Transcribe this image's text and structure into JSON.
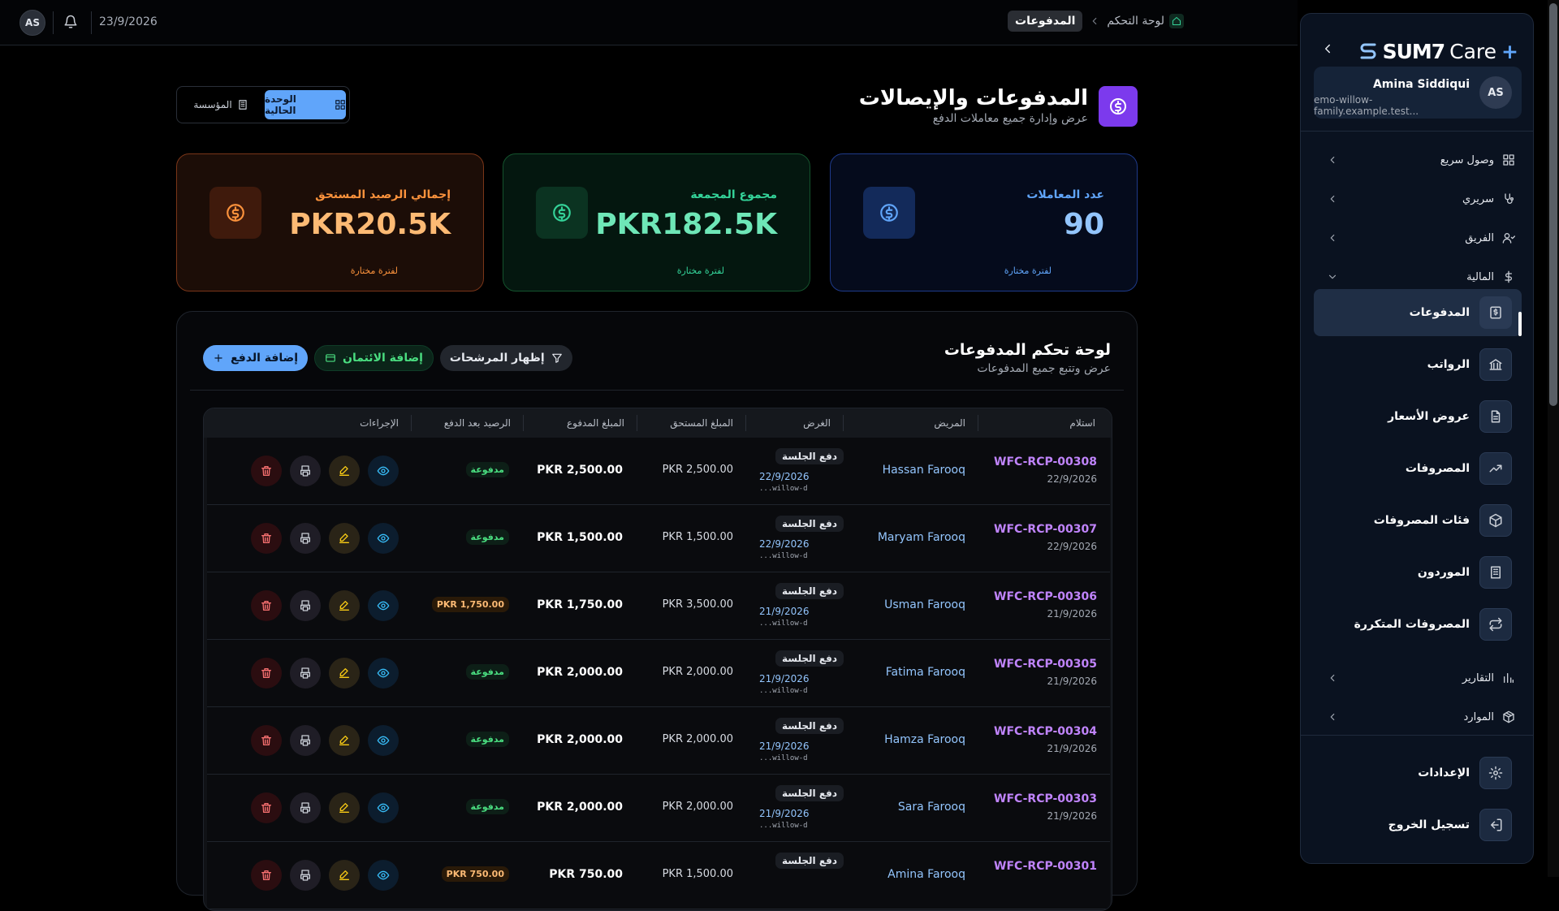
{
  "topbar": {
    "avatar_initials": "AS",
    "date": "23/9/2026",
    "breadcrumb_home": "لوحة التحكم",
    "breadcrumb_current": "المدفوعات"
  },
  "header": {
    "title": "المدفوعات والإيصالات",
    "subtitle": "عرض وإدارة جميع معاملات الدفع",
    "scope_current": "الوحدة الحالية",
    "scope_org": "المؤسسة"
  },
  "cards": {
    "transactions": {
      "title": "عدد المعاملات",
      "value": "90",
      "sub": "لفترة مختارة"
    },
    "collected": {
      "title": "مجموع المجمعة",
      "value": "PKR182.5K",
      "sub": "لفترة مختارة"
    },
    "balance": {
      "title": "إجمالي الرصيد المستحق",
      "value": "PKR20.5K",
      "sub": "لفترة مختارة"
    }
  },
  "panel": {
    "title": "لوحة تحكم المدفوعات",
    "subtitle": "عرض وتتبع جميع المدفوعات",
    "btn_filters": "إظهار المرشحات",
    "btn_credit": "إضافة الائتمان",
    "btn_add_payment": "إضافة الدفع"
  },
  "table": {
    "columns": [
      "استلام",
      "المريض",
      "الغرض",
      "المبلغ المستحق",
      "المبلغ المدفوع",
      "الرصيد بعد الدفع",
      "الإجراءات"
    ],
    "rows": [
      {
        "receipt": "WFC-RCP-00308",
        "date": "22/9/2026",
        "patient": "Hassan Farooq",
        "purpose": "دفع الجلسة",
        "purpose_date": "22/9/2026",
        "ref": "...willow-d",
        "due": "PKR 2,500.00",
        "paid": "PKR 2,500.00",
        "balance": "مدفوعة",
        "settled": true
      },
      {
        "receipt": "WFC-RCP-00307",
        "date": "22/9/2026",
        "patient": "Maryam Farooq",
        "purpose": "دفع الجلسة",
        "purpose_date": "22/9/2026",
        "ref": "...willow-d",
        "due": "PKR 1,500.00",
        "paid": "PKR 1,500.00",
        "balance": "مدفوعة",
        "settled": true
      },
      {
        "receipt": "WFC-RCP-00306",
        "date": "21/9/2026",
        "patient": "Usman Farooq",
        "purpose": "دفع الجلسة",
        "purpose_date": "21/9/2026",
        "ref": "...willow-d",
        "due": "PKR 3,500.00",
        "paid": "PKR 1,750.00",
        "balance": "PKR 1,750.00",
        "settled": false
      },
      {
        "receipt": "WFC-RCP-00305",
        "date": "21/9/2026",
        "patient": "Fatima Farooq",
        "purpose": "دفع الجلسة",
        "purpose_date": "21/9/2026",
        "ref": "...willow-d",
        "due": "PKR 2,000.00",
        "paid": "PKR 2,000.00",
        "balance": "مدفوعة",
        "settled": true
      },
      {
        "receipt": "WFC-RCP-00304",
        "date": "21/9/2026",
        "patient": "Hamza Farooq",
        "purpose": "دفع الجلسة",
        "purpose_date": "21/9/2026",
        "ref": "...willow-d",
        "due": "PKR 2,000.00",
        "paid": "PKR 2,000.00",
        "balance": "مدفوعة",
        "settled": true
      },
      {
        "receipt": "WFC-RCP-00303",
        "date": "21/9/2026",
        "patient": "Sara Farooq",
        "purpose": "دفع الجلسة",
        "purpose_date": "21/9/2026",
        "ref": "...willow-d",
        "due": "PKR 2,000.00",
        "paid": "PKR 2,000.00",
        "balance": "مدفوعة",
        "settled": true
      },
      {
        "receipt": "WFC-RCP-00301",
        "date": "",
        "patient": "Amina Farooq",
        "purpose": "دفع الجلسة",
        "purpose_date": "",
        "ref": "",
        "due": "PKR 1,500.00",
        "paid": "PKR 750.00",
        "balance": "PKR 750.00",
        "settled": false
      }
    ]
  },
  "sidebar": {
    "brand_word": "SUM7",
    "brand_care": "Care",
    "brand_plus": "+",
    "user_name": "Amina Siddiqui",
    "user_email": "emo-willow-family.example.test...",
    "user_initials": "AS",
    "nav": [
      {
        "label": "وصول سريع",
        "icon": "grid-icon"
      },
      {
        "label": "سريري",
        "icon": "stethoscope-icon"
      },
      {
        "label": "الفريق",
        "icon": "users-icon"
      },
      {
        "label": "المالية",
        "icon": "dollar-icon"
      }
    ],
    "finance_items": [
      {
        "label": "المدفوعات",
        "icon": "receipt-dollar-icon",
        "active": true
      },
      {
        "label": "الرواتب",
        "icon": "bank-icon"
      },
      {
        "label": "عروض الأسعار",
        "icon": "document-icon"
      },
      {
        "label": "المصروفات",
        "icon": "trending-up-icon"
      },
      {
        "label": "فئات المصروفات",
        "icon": "box-icon"
      },
      {
        "label": "الموردون",
        "icon": "building-icon"
      },
      {
        "label": "المصروفات المتكررة",
        "icon": "repeat-icon"
      }
    ],
    "nav_bottom": [
      {
        "label": "التقارير",
        "icon": "chart-icon"
      },
      {
        "label": "الموارد",
        "icon": "package-icon"
      }
    ],
    "settings": "الإعدادات",
    "logout": "تسجيل الخروج"
  },
  "colors": {
    "accent": "#60a5fa",
    "purple": "#7c3aed",
    "success": "#4ade80",
    "warning": "#fb923c"
  }
}
